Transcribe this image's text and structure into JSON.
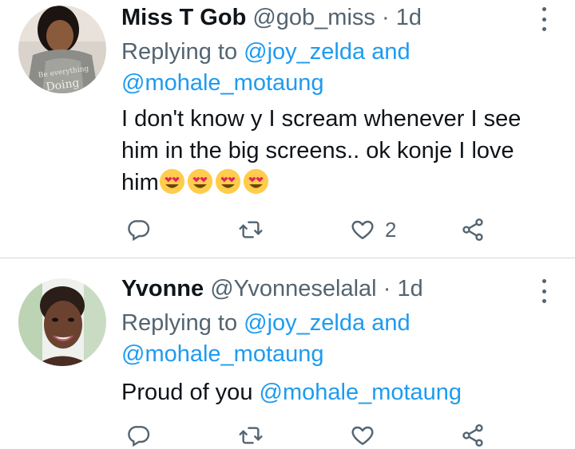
{
  "tweets": [
    {
      "name": "Miss T Gob",
      "handle": "@gob_miss",
      "separator": "·",
      "time": "1d",
      "replying_prefix": "Replying to",
      "reply_to_1": "@joy_zelda",
      "reply_and": "and",
      "reply_to_2": "@mohale_motaung",
      "text": "I don't know y I scream whenever I see him in the big screens.. ok konje I love him",
      "emojis": [
        "smiling-face-with-heart-eyes",
        "smiling-face-with-heart-eyes",
        "smiling-face-with-heart-eyes",
        "smiling-face-with-heart-eyes"
      ],
      "like_count": "2"
    },
    {
      "name": "Yvonne",
      "handle": "@Yvonneselalal",
      "separator": "·",
      "time": "1d",
      "replying_prefix": "Replying to",
      "reply_to_1": "@joy_zelda",
      "reply_and": "and",
      "reply_to_2": "@mohale_motaung",
      "text_prefix": "Proud of you",
      "text_mention": "@mohale_motaung",
      "like_count": ""
    }
  ],
  "icons": {
    "reply": "reply-icon",
    "retweet": "retweet-icon",
    "like": "heart-icon",
    "share": "share-icon",
    "more": "more-vertical-icon"
  },
  "colors": {
    "text": "#0f1419",
    "secondary": "#536471",
    "link": "#1d9bf0",
    "divider": "#cfd9de"
  }
}
